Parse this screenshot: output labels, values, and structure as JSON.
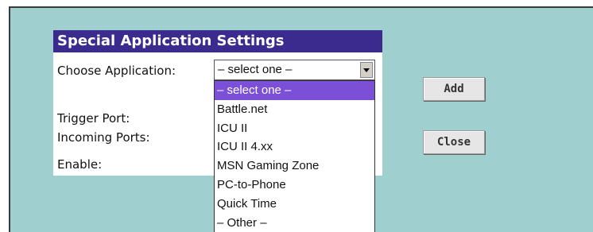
{
  "panel": {
    "title": "Special Application Settings",
    "labels": {
      "choose_application": "Choose Application:",
      "trigger_port": "Trigger Port:",
      "incoming_ports": "Incoming Ports:",
      "enable": "Enable:"
    }
  },
  "application_select": {
    "value": "– select one –",
    "options": [
      "– select one –",
      "Battle.net",
      "ICU II",
      "ICU II 4.xx",
      "MSN Gaming Zone",
      "PC-to-Phone",
      "Quick Time",
      "– Other –"
    ],
    "highlighted_index": 0
  },
  "buttons": {
    "add": "Add",
    "close": "Close"
  },
  "colors": {
    "panel_background": "#9fcfcf",
    "header_background": "#3b2b8e",
    "selected_option": "#7b4fd6"
  }
}
